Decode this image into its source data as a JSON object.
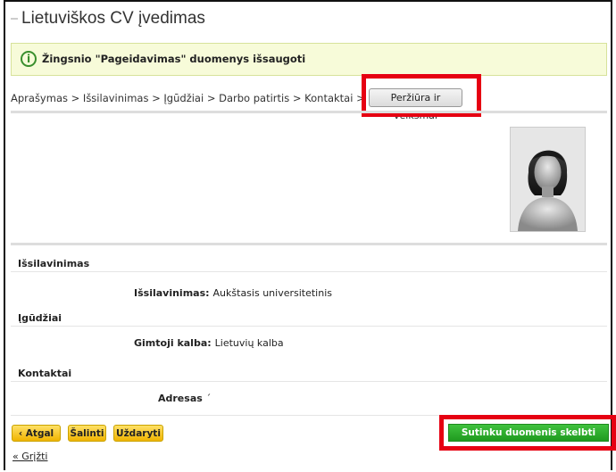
{
  "page": {
    "title": "Lietuviškos CV įvedimas"
  },
  "notice": {
    "icon": "info-icon",
    "text": "Žingsnio \"Pageidavimas\" duomenys išsaugoti",
    "colors": {
      "background": "#f7fbd9",
      "accent": "#3a8f2e"
    }
  },
  "breadcrumb": {
    "text": "Aprašymas > Išsilavinimas > Įgūdžiai > Darbo patirtis > Kontaktai > Pageidavimas"
  },
  "preview_button": {
    "label": "Peržiūra ir veiksmai"
  },
  "sections": {
    "education": {
      "heading": "Išsilavinimas",
      "label": "Išsilavinimas:",
      "value": "Aukštasis universitetinis"
    },
    "skills": {
      "heading": "Įgūdžiai",
      "label": "Gimtoji kalba:",
      "value": "Lietuvių kalba"
    },
    "contacts": {
      "heading": "Kontaktai",
      "label": "Adresas",
      "value": "´"
    }
  },
  "actions": {
    "back_label": "‹ Atgal",
    "delete_label": "Šalinti",
    "close_label": "Uždaryti",
    "publish_label": "Sutinku duomenis skelbti svetainėje"
  },
  "footer": {
    "back_link": "« Grįžti"
  },
  "highlight_color": "#e60012"
}
